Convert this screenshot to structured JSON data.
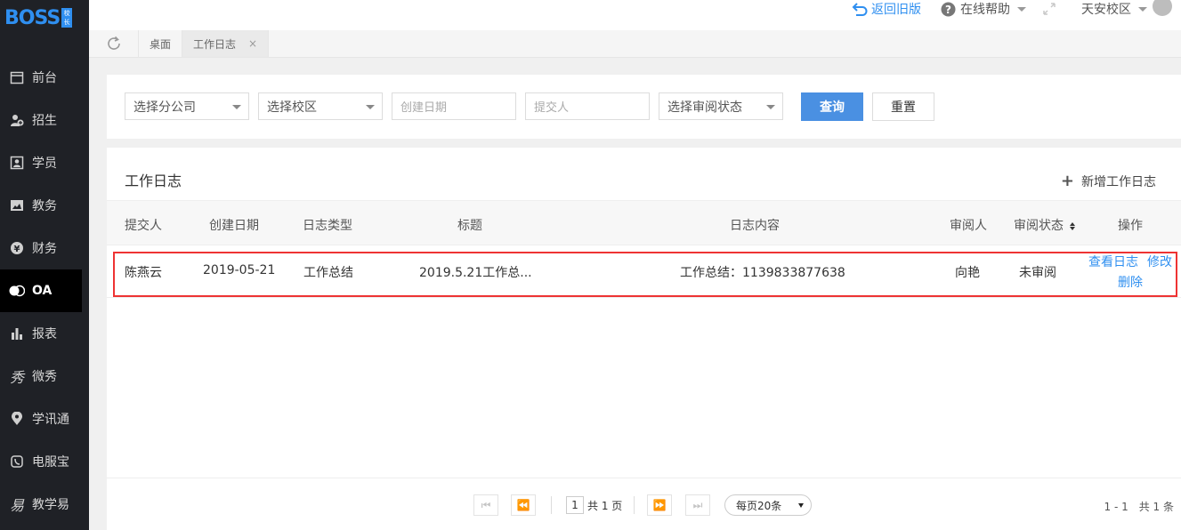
{
  "logo": {
    "text": "BOSS",
    "badge_top": "校",
    "badge_bottom": "长"
  },
  "sidebar": {
    "items": [
      {
        "label": "前台",
        "icon": "calendar-icon"
      },
      {
        "label": "招生",
        "icon": "user-add-icon"
      },
      {
        "label": "学员",
        "icon": "id-card-icon"
      },
      {
        "label": "教务",
        "icon": "picture-icon"
      },
      {
        "label": "财务",
        "icon": "yen-icon"
      },
      {
        "label": "OA",
        "icon": "toggle-icon",
        "active": true
      },
      {
        "label": "报表",
        "icon": "bar-chart-icon"
      },
      {
        "label": "微秀",
        "icon": "xiu-icon"
      },
      {
        "label": "学讯通",
        "icon": "location-pin-icon"
      },
      {
        "label": "电服宝",
        "icon": "phone-icon"
      },
      {
        "label": "教学易",
        "icon": "yi-icon"
      }
    ]
  },
  "topbar": {
    "back_old": "返回旧版",
    "help": "在线帮助",
    "campus": "天安校区"
  },
  "tabs": [
    {
      "label": "桌面"
    },
    {
      "label": "工作日志",
      "active": true,
      "closable": "×"
    }
  ],
  "filter": {
    "company": "选择分公司",
    "campus": "选择校区",
    "date_placeholder": "创建日期",
    "submitter_placeholder": "提交人",
    "review_status": "选择审阅状态",
    "query_label": "查询",
    "reset_label": "重置"
  },
  "panel": {
    "title": "工作日志",
    "add_label": "新增工作日志"
  },
  "table": {
    "headers": [
      "提交人",
      "创建日期",
      "日志类型",
      "标题",
      "日志内容",
      "审阅人",
      "审阅状态",
      "操作"
    ],
    "rows": [
      {
        "submitter": "陈燕云",
        "date": "2019-05-21",
        "type": "工作总结",
        "title": "2019.5.21工作总...",
        "content": "工作总结：1139833877638",
        "reviewer": "向艳",
        "status": "未审阅",
        "actions": {
          "view": "查看日志",
          "edit": "修改",
          "delete": "删除"
        }
      }
    ]
  },
  "pagination": {
    "page": "1",
    "total_pages": "共 1 页",
    "per_page": "每页20条",
    "range": "1 - 1　共 1 条"
  },
  "colors": {
    "accent": "#2f8ff0",
    "sidebar_bg": "#1f2126",
    "highlight": "#e33333"
  }
}
